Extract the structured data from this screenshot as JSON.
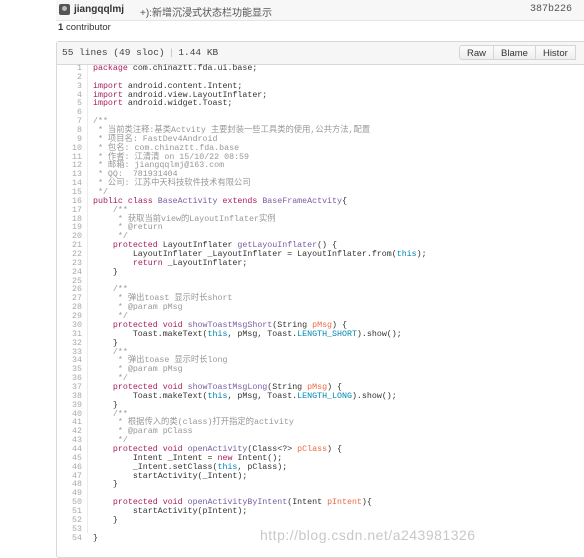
{
  "commit": {
    "author": "jiangqqlmj",
    "message": "+):新增沉浸式状态栏功能显示",
    "sha": "387b226"
  },
  "contributors": {
    "count": "1",
    "label": "contributor"
  },
  "file": {
    "lines": "55 lines (49 sloc)",
    "size": "1.44 KB",
    "buttons": {
      "raw": "Raw",
      "blame": "Blame",
      "history": "Histor"
    }
  },
  "code_lines": [
    {
      "n": "1",
      "t": "package com.chinaztt.fda.ui.base;"
    },
    {
      "n": "2",
      "t": ""
    },
    {
      "n": "3",
      "t": "import android.content.Intent;"
    },
    {
      "n": "4",
      "t": "import android.view.LayoutInflater;"
    },
    {
      "n": "5",
      "t": "import android.widget.Toast;"
    },
    {
      "n": "6",
      "t": ""
    },
    {
      "n": "7",
      "t": "/**"
    },
    {
      "n": "8",
      "t": " * 当前类注释:基类Actvity 主要封装一些工具类的使用,公共方法,配置"
    },
    {
      "n": "9",
      "t": " * 项目名: FastDev4Android"
    },
    {
      "n": "10",
      "t": " * 包名: com.chinaztt.fda.base"
    },
    {
      "n": "11",
      "t": " * 作者: 江清清 on 15/10/22 08:59"
    },
    {
      "n": "12",
      "t": " * 邮箱: jiangqqlmj@163.com"
    },
    {
      "n": "13",
      "t": " * QQ:  781931404"
    },
    {
      "n": "14",
      "t": " * 公司: 江苏中天科技软件技术有限公司"
    },
    {
      "n": "15",
      "t": " */"
    },
    {
      "n": "16",
      "t": "public class BaseActivity extends BaseFrameActvity{"
    },
    {
      "n": "17",
      "t": "    /**"
    },
    {
      "n": "18",
      "t": "     * 获取当前view的LayoutInflater实例"
    },
    {
      "n": "19",
      "t": "     * @return"
    },
    {
      "n": "20",
      "t": "     */"
    },
    {
      "n": "21",
      "t": "    protected LayoutInflater getLayouInflater() {"
    },
    {
      "n": "22",
      "t": "        LayoutInflater _LayoutInflater = LayoutInflater.from(this);"
    },
    {
      "n": "23",
      "t": "        return _LayoutInflater;"
    },
    {
      "n": "24",
      "t": "    }"
    },
    {
      "n": "25",
      "t": ""
    },
    {
      "n": "26",
      "t": "    /**"
    },
    {
      "n": "27",
      "t": "     * 弹出toast 显示时长short"
    },
    {
      "n": "28",
      "t": "     * @param pMsg"
    },
    {
      "n": "29",
      "t": "     */"
    },
    {
      "n": "30",
      "t": "    protected void showToastMsgShort(String pMsg) {"
    },
    {
      "n": "31",
      "t": "        Toast.makeText(this, pMsg, Toast.LENGTH_SHORT).show();"
    },
    {
      "n": "32",
      "t": "    }"
    },
    {
      "n": "33",
      "t": "    /**"
    },
    {
      "n": "34",
      "t": "     * 弹出toase 显示时长long"
    },
    {
      "n": "35",
      "t": "     * @param pMsg"
    },
    {
      "n": "36",
      "t": "     */"
    },
    {
      "n": "37",
      "t": "    protected void showToastMsgLong(String pMsg) {"
    },
    {
      "n": "38",
      "t": "        Toast.makeText(this, pMsg, Toast.LENGTH_LONG).show();"
    },
    {
      "n": "39",
      "t": "    }"
    },
    {
      "n": "40",
      "t": "    /**"
    },
    {
      "n": "41",
      "t": "     * 根据传入的类(class)打开指定的activity"
    },
    {
      "n": "42",
      "t": "     * @param pClass"
    },
    {
      "n": "43",
      "t": "     */"
    },
    {
      "n": "44",
      "t": "    protected void openActivity(Class<?> pClass) {"
    },
    {
      "n": "45",
      "t": "        Intent _Intent = new Intent();"
    },
    {
      "n": "46",
      "t": "        _Intent.setClass(this, pClass);"
    },
    {
      "n": "47",
      "t": "        startActivity(_Intent);"
    },
    {
      "n": "48",
      "t": "    }"
    },
    {
      "n": "49",
      "t": ""
    },
    {
      "n": "50",
      "t": "    protected void openActivityByIntent(Intent pIntent){"
    },
    {
      "n": "51",
      "t": "        startActivity(pIntent);"
    },
    {
      "n": "52",
      "t": "    }"
    },
    {
      "n": "53",
      "t": ""
    },
    {
      "n": "54",
      "t": "}"
    }
  ],
  "syntax_colors": {
    "keyword": "#a71d5d",
    "entity": "#795da3",
    "constant": "#0086b3",
    "comment": "#969896",
    "text": "#333333"
  },
  "watermark": "http://blog.csdn.net/a243981326"
}
